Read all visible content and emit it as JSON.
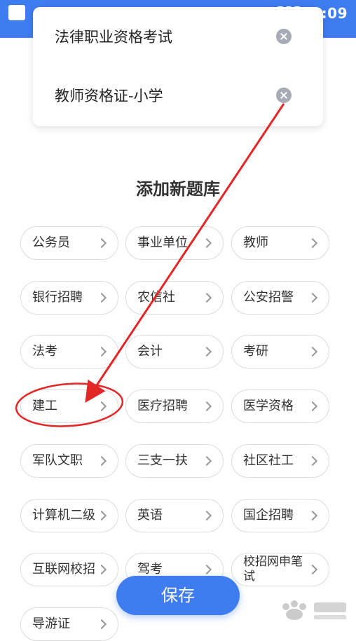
{
  "status_bar": {
    "time": "5:09"
  },
  "popup": {
    "items": [
      {
        "label": "法律职业资格考试"
      },
      {
        "label": "教师资格证-小学"
      }
    ]
  },
  "section_title": "添加新题库",
  "categories": [
    "公务员",
    "事业单位",
    "教师",
    "银行招聘",
    "农信社",
    "公安招警",
    "法考",
    "会计",
    "考研",
    "建工",
    "医疗招聘",
    "医学资格",
    "军队文职",
    "三支一扶",
    "社区社工",
    "计算机二级",
    "英语",
    "国企招聘",
    "互联网校招",
    "驾考",
    "校招网申笔试",
    "导游证"
  ],
  "save_button": {
    "label": "保存"
  },
  "annotation_color": "#e32626",
  "brand_color": "#3f7cf0"
}
